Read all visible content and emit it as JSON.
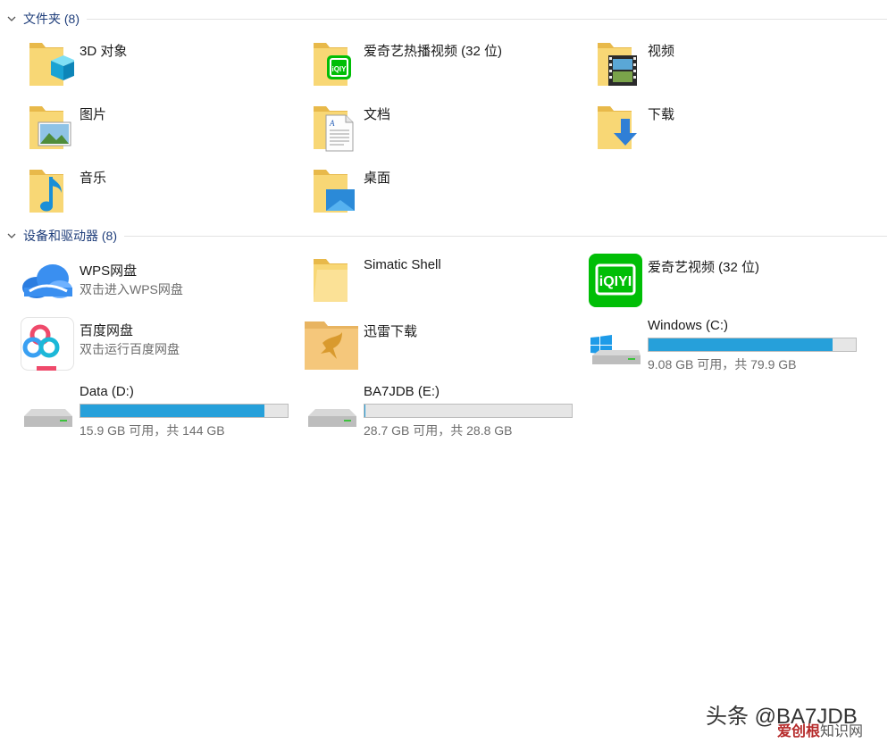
{
  "groups": {
    "folders": {
      "title": "文件夹 (8)"
    },
    "devices": {
      "title": "设备和驱动器 (8)"
    }
  },
  "folders": [
    {
      "name": "3D 对象",
      "icon": "3d-objects-folder-icon"
    },
    {
      "name": "爱奇艺热播视频 (32 位)",
      "icon": "iqiyi-folder-icon"
    },
    {
      "name": "视频",
      "icon": "videos-folder-icon"
    },
    {
      "name": "图片",
      "icon": "pictures-folder-icon"
    },
    {
      "name": "文档",
      "icon": "documents-folder-icon"
    },
    {
      "name": "下载",
      "icon": "downloads-folder-icon"
    },
    {
      "name": "音乐",
      "icon": "music-folder-icon"
    },
    {
      "name": "桌面",
      "icon": "desktop-folder-icon"
    }
  ],
  "devices": {
    "wps": {
      "name": "WPS网盘",
      "sub": "双击进入WPS网盘",
      "icon": "wps-cloud-icon"
    },
    "simatic": {
      "name": "Simatic Shell",
      "icon": "folder-icon"
    },
    "iqiyi": {
      "name": "爱奇艺视频 (32 位)",
      "icon": "iqiyi-app-icon"
    },
    "baidu": {
      "name": "百度网盘",
      "sub": "双击运行百度网盘",
      "icon": "baidu-netdisk-icon"
    },
    "xunlei": {
      "name": "迅雷下载",
      "icon": "xunlei-folder-icon"
    }
  },
  "drives": {
    "c": {
      "name": "Windows (C:)",
      "detail": "9.08 GB 可用，共 79.9 GB",
      "used_fraction": 0.886,
      "icon": "windows-drive-icon"
    },
    "d": {
      "name": "Data (D:)",
      "detail": "15.9 GB 可用，共 144 GB",
      "used_fraction": 0.89,
      "icon": "drive-icon"
    },
    "e": {
      "name": "BA7JDB (E:)",
      "detail": "28.7 GB 可用，共 28.8 GB",
      "used_fraction": 0.003,
      "icon": "drive-icon"
    }
  },
  "colors": {
    "group_title": "#1e3d7a",
    "usage_bar": "#26a0da",
    "folder": "#f8d775"
  },
  "watermark": {
    "line1": "头条 @BA7JDB",
    "line2a": "爱创根",
    "line2b": "知识网"
  }
}
